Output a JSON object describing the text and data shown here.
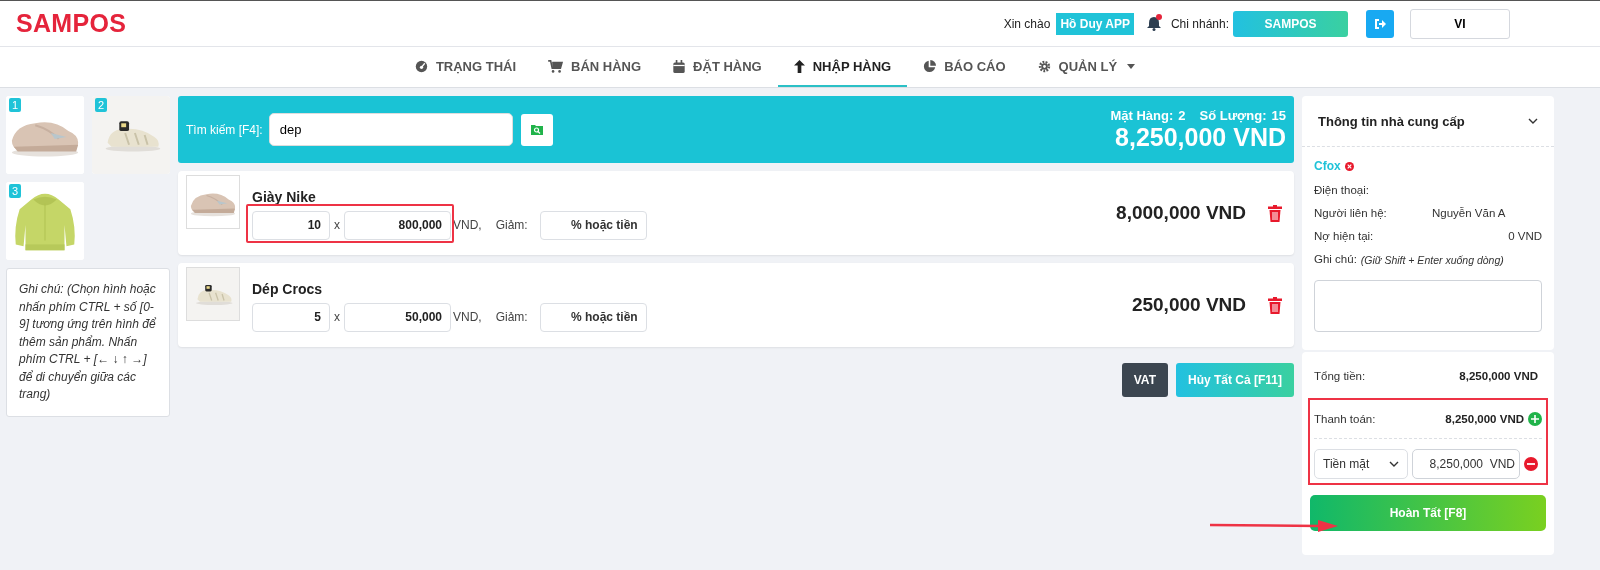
{
  "header": {
    "logo": "SAMPOS",
    "greeting": "Xin chào",
    "user": "Hồ Duy APP",
    "notification": true,
    "branch_label": "Chi nhánh:",
    "branch": "SAMPOS",
    "language": "VI"
  },
  "nav": [
    {
      "label": "TRẠNG THÁI",
      "selected": false
    },
    {
      "label": "BÁN HÀNG",
      "selected": false
    },
    {
      "label": "ĐẶT HÀNG",
      "selected": false
    },
    {
      "label": "NHẬP HÀNG",
      "selected": true
    },
    {
      "label": "BÁO CÁO",
      "selected": false
    },
    {
      "label": "QUẢN LÝ",
      "selected": false
    }
  ],
  "thumbnails": [
    {
      "number": "1",
      "kind": "picture"
    },
    {
      "number": "2",
      "kind": "picture"
    },
    {
      "number": "3",
      "kind": "picture"
    }
  ],
  "note": "Ghi chú: (Chọn hình hoặc nhấn phím CTRL + số [0-9] tương ứng trên hình để thêm sản phẩm. Nhấn phím CTRL + [← ↓ ↑ →] để di chuyển giữa các trang)",
  "search": {
    "label": "Tìm kiếm [F4]:",
    "value": "dep"
  },
  "summary": {
    "items_label": "Mặt Hàng:",
    "items": "2",
    "quantity_label": "Số Lượng:",
    "quantity": "15",
    "total": "8,250,000 VND"
  },
  "products": [
    {
      "name": "Giày Nike",
      "quantity": "10",
      "times": "x",
      "price": "800,000",
      "currency": "VND,",
      "discount_label": "Giảm:",
      "discount_placeholder": "% hoặc tiền",
      "total": "8,000,000 VND",
      "highlighted": true
    },
    {
      "name": "Dép Crocs",
      "quantity": "5",
      "times": "x",
      "price": "50,000",
      "currency": "VND,",
      "discount_label": "Giảm:",
      "discount_placeholder": "% hoặc tiền",
      "total": "250,000 VND",
      "highlighted": false
    }
  ],
  "actions": [
    {
      "label": "VAT",
      "kind": "dark"
    },
    {
      "label": "Hủy Tất Cả [F11]",
      "kind": "gradient"
    }
  ],
  "supplier": {
    "title": "Thông tin nhà cung cấp",
    "expanded": true,
    "name": "Cfox",
    "fields": [
      {
        "label": "Điện thoại:"
      },
      {
        "label": "Người liên hệ:",
        "value": "Nguyễn Văn A"
      },
      {
        "label": "Nợ hiện tại:",
        "value": "0 VND"
      }
    ],
    "note_label": "Ghi chú:",
    "note_hint": "(Giữ Shift + Enter xuống dòng)"
  },
  "payment": {
    "total_label": "Tổng tiền:",
    "total": "8,250,000 VND",
    "paid_label": "Thanh toán:",
    "paid": "8,250,000 VND",
    "method": "Tiền mặt",
    "amount": "8,250,000",
    "currency": "VND",
    "highlighted": true
  },
  "finish_button": {
    "label": "Hoàn Tất [F8]",
    "pointed": true
  }
}
